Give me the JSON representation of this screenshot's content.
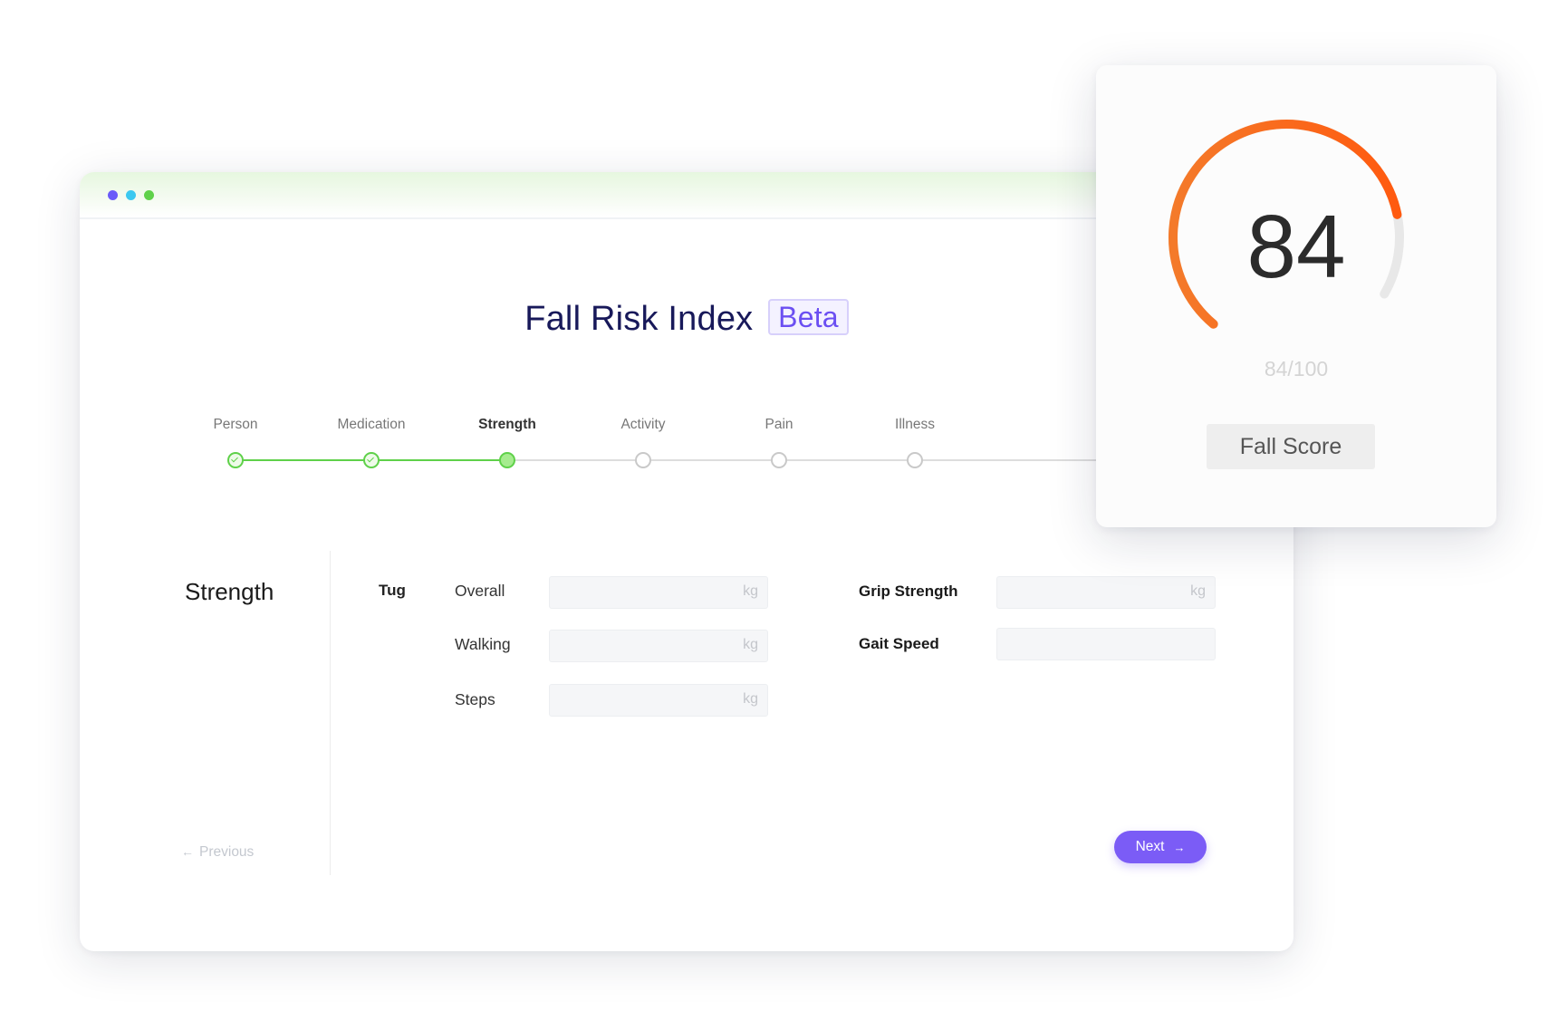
{
  "window": {
    "dots": [
      {
        "name": "window-dot-purple",
        "color": "#6a5af9"
      },
      {
        "name": "window-dot-cyan",
        "color": "#3bc8f0"
      },
      {
        "name": "window-dot-green",
        "color": "#5fd14a"
      }
    ]
  },
  "header": {
    "title": "Fall Risk Index",
    "badge": "Beta"
  },
  "stepper": {
    "steps": [
      {
        "label": "Person",
        "status": "done"
      },
      {
        "label": "Medication",
        "status": "done"
      },
      {
        "label": "Strength",
        "status": "active"
      },
      {
        "label": "Activity",
        "status": "pending"
      },
      {
        "label": "Pain",
        "status": "pending"
      },
      {
        "label": "Illness",
        "status": "pending"
      }
    ],
    "complete_color": "#5fd14a",
    "pending_color": "#dddddd"
  },
  "form": {
    "section_title": "Strength",
    "group_label": "Tug",
    "fields": {
      "overall": {
        "label": "Overall",
        "unit": "kg",
        "value": ""
      },
      "walking": {
        "label": "Walking",
        "unit": "kg",
        "value": ""
      },
      "steps": {
        "label": "Steps",
        "unit": "kg",
        "value": ""
      },
      "grip_strength": {
        "label": "Grip Strength",
        "unit": "kg",
        "value": ""
      },
      "gait_speed": {
        "label": "Gait Speed",
        "unit": "",
        "value": ""
      }
    }
  },
  "navigation": {
    "previous_label": "Previous",
    "next_label": "Next",
    "accent_color": "#7b5cf6"
  },
  "score_card": {
    "score": "84",
    "score_out_of": "84/100",
    "label": "Fall Score",
    "progress_fraction": 0.84,
    "gauge_start_color": "#f47a2a",
    "gauge_end_color": "#ff5a0f",
    "track_color": "#e8e8e8"
  }
}
